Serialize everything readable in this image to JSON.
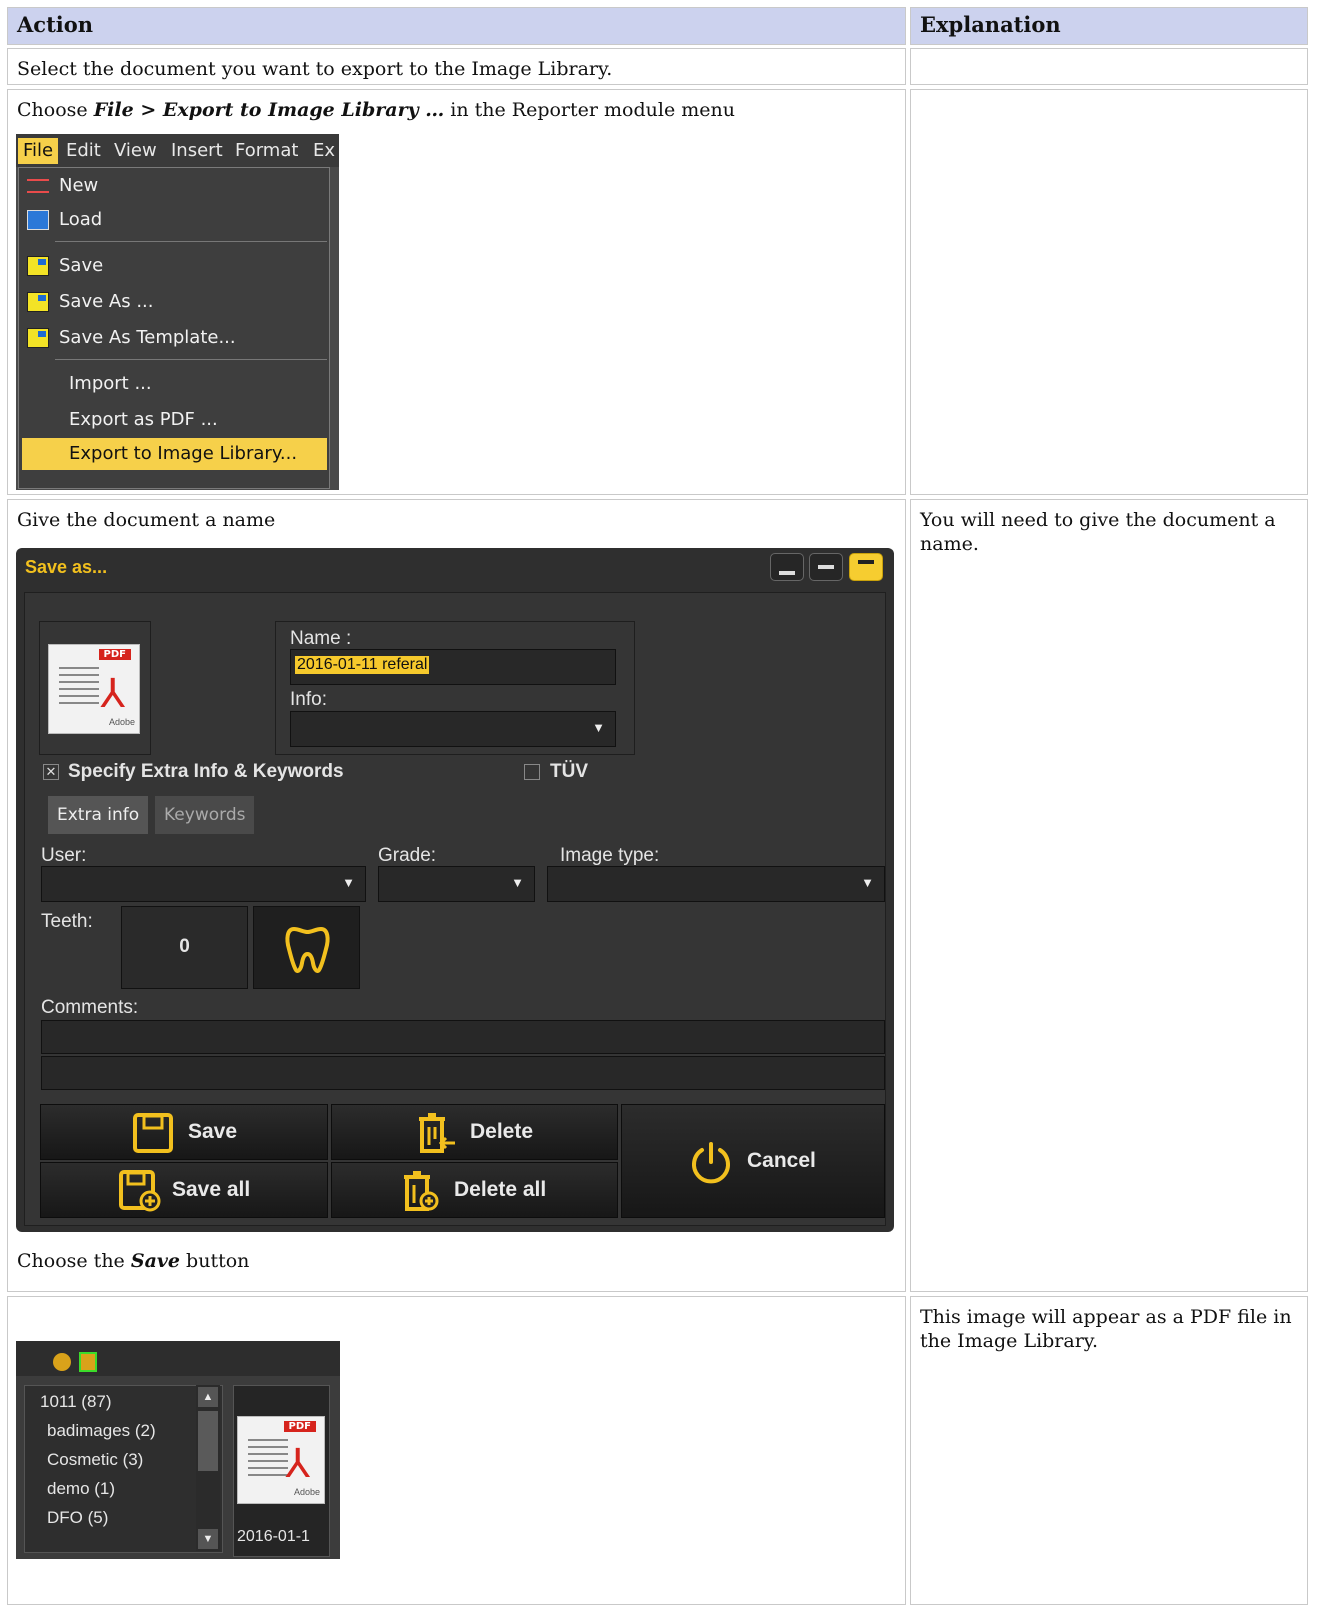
{
  "table": {
    "headers": {
      "action": "Action",
      "explanation": "Explanation"
    }
  },
  "row1": {
    "action": "Select the document you want to export to the Image Library.",
    "explanation": ""
  },
  "row2": {
    "pre": "Choose ",
    "file": "File",
    "sep": " > ",
    "export": "Export to Image Library …",
    "post": " in the Reporter module menu",
    "explanation": ""
  },
  "menu": {
    "bar": [
      "File",
      "Edit",
      "View",
      "Insert",
      "Format",
      "Ex"
    ],
    "items": [
      "New",
      "Load",
      "Save",
      "Save As ...",
      "Save As Template...",
      "Import ...",
      "Export as PDF ...",
      "Export to Image Library..."
    ]
  },
  "row3": {
    "action_top": "Give the document a name",
    "action_bottom_pre": "Choose the ",
    "action_bottom_em": "Save",
    "action_bottom_post": " button",
    "explanation": "You will need to give the document a name."
  },
  "dialog": {
    "title": "Save as...",
    "name_label": "Name :",
    "name_value": "2016-01-11  referal",
    "info_label": "Info:",
    "extra_check_mark": "✕",
    "extra_label": "Specify Extra Info & Keywords",
    "tuv_label": "TÜV",
    "tabs": [
      "Extra info",
      "Keywords"
    ],
    "user_label": "User:",
    "grade_label": "Grade:",
    "image_type_label": "Image type:",
    "teeth_label": "Teeth:",
    "teeth_value": "0",
    "comments_label": "Comments:",
    "buttons": {
      "save": "Save",
      "save_all": "Save all",
      "delete": "Delete",
      "delete_all": "Delete all",
      "cancel": "Cancel"
    },
    "pdf_tag": "PDF",
    "pdf_brand": "Adobe"
  },
  "row4": {
    "action": "",
    "explanation": "This image will appear as a PDF file in the Image Library."
  },
  "library": {
    "tree": [
      "1011 (87)",
      "badimages (2)",
      "Cosmetic (3)",
      "demo (1)",
      "DFO (5)"
    ],
    "thumb_caption": "2016-01-1",
    "pdf_tag": "PDF",
    "pdf_brand": "Adobe"
  },
  "colors": {
    "header_bg": "#ccd2ee",
    "accent": "#f6c92c",
    "dialog_bg": "#2f2f2f"
  }
}
